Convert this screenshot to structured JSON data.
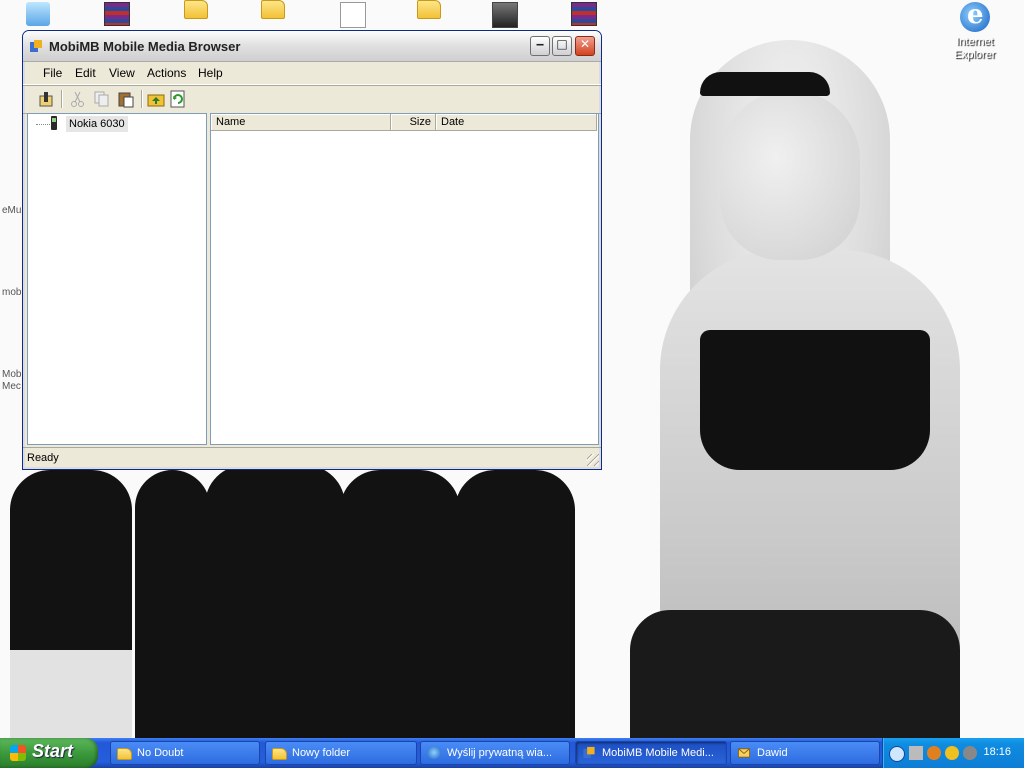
{
  "window": {
    "title": "MobiMB Mobile Media Browser",
    "menu": [
      "File",
      "Edit",
      "View",
      "Actions",
      "Help"
    ],
    "tree": {
      "device": "Nokia 6030"
    },
    "columns": [
      "Name",
      "Size",
      "Date"
    ],
    "status": "Ready"
  },
  "desktop": {
    "ie_label_line1": "Internet",
    "ie_label_line2": "Explorer",
    "side_labels": [
      "eMu",
      "mob",
      "Mob",
      "Mec"
    ]
  },
  "taskbar": {
    "start": "Start",
    "tasks": [
      "No Doubt",
      "Nowy folder",
      "Wyślij prywatną wia...",
      "MobiMB Mobile Medi...",
      "Dawid"
    ],
    "clock": "18:16"
  }
}
